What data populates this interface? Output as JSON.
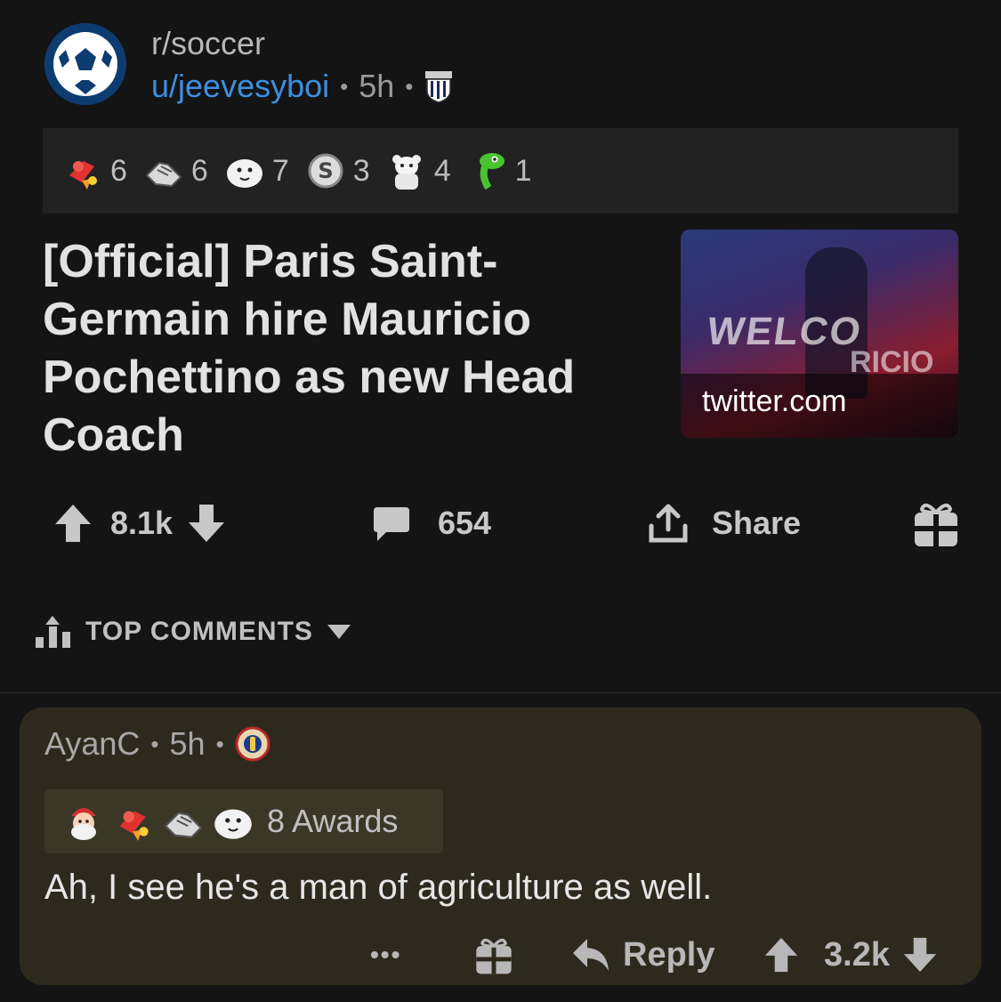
{
  "post": {
    "subreddit": "r/soccer",
    "author": "u/jeevesyboi",
    "age": "5h",
    "author_flair": "west-brom-crest-icon",
    "awards": [
      {
        "icon": "rocket-like-award-icon",
        "count": "6"
      },
      {
        "icon": "handshake-award-icon",
        "count": "6"
      },
      {
        "icon": "wholesome-seal-award-icon",
        "count": "7"
      },
      {
        "icon": "silver-award-icon",
        "count": "3"
      },
      {
        "icon": "bear-award-icon",
        "count": "4"
      },
      {
        "icon": "dinosaur-award-icon",
        "count": "1"
      }
    ],
    "title": "[Official] Paris Saint-Germain hire Mauricio Pochettino as new Head Coach",
    "thumbnail": {
      "domain": "twitter.com",
      "text_left": "WELCO",
      "text_right": "RICIO"
    },
    "score": "8.1k",
    "comments": "654",
    "share_label": "Share"
  },
  "sort": {
    "label": "TOP COMMENTS"
  },
  "comment": {
    "author": "AyanC",
    "age": "5h",
    "author_flair": "east-bengal-crest-icon",
    "award_icons": [
      "santa-award-icon",
      "rocket-like-award-icon",
      "handshake-award-icon",
      "wholesome-seal-award-icon"
    ],
    "awards_label": "8 Awards",
    "body": "Ah, I see he's a man of agriculture as well.",
    "more": "•••",
    "reply_label": "Reply",
    "score": "3.2k"
  },
  "colors": {
    "background": "#141414",
    "username": "#3d8fe0",
    "comment_bg": "#2d2a1d"
  }
}
